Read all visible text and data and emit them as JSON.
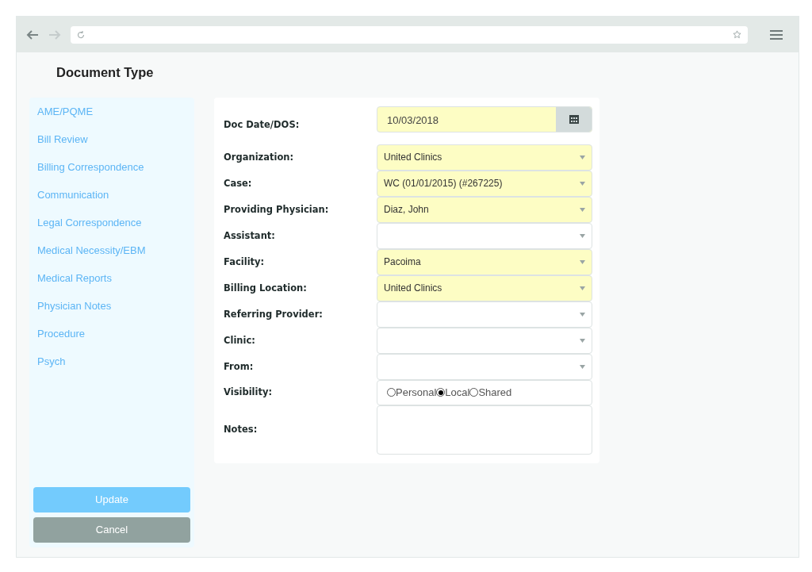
{
  "page_title": "Document Type",
  "sidebar": {
    "items": [
      {
        "label": "AME/PQME",
        "selected": false
      },
      {
        "label": "Bill Review",
        "selected": false
      },
      {
        "label": "Billing Correspondence",
        "selected": false
      },
      {
        "label": "Communication",
        "selected": false
      },
      {
        "label": "Legal Correspondence",
        "selected": false
      },
      {
        "label": "Medical Necessity/EBM",
        "selected": false
      },
      {
        "label": "Medical Reports",
        "selected": false
      },
      {
        "label": "Physician Notes",
        "selected": false
      },
      {
        "label": "Procedure",
        "selected": false
      },
      {
        "label": "Psych",
        "selected": false
      }
    ],
    "buttons": [
      {
        "label": "Update",
        "kind": "primary"
      },
      {
        "label": "Cancel",
        "kind": "secondary"
      }
    ]
  },
  "form": {
    "fields": [
      {
        "kind": "date",
        "label": "Doc Date/DOS:",
        "value": "10/03/2018",
        "highlighted": true
      },
      {
        "kind": "select",
        "label": "Organization:",
        "value": "United Clinics",
        "highlighted": true
      },
      {
        "kind": "select",
        "label": "Case:",
        "value": "WC (01/01/2015) (#267225)",
        "highlighted": true
      },
      {
        "kind": "select",
        "label": "Providing Physician:",
        "value": "Diaz, John",
        "highlighted": true
      },
      {
        "kind": "select",
        "label": "Assistant:",
        "highlighted": false
      },
      {
        "kind": "select",
        "label": "Facility:",
        "value": "Pacoima",
        "highlighted": true
      },
      {
        "kind": "select",
        "label": "Billing Location:",
        "value": "United Clinics",
        "highlighted": true
      },
      {
        "kind": "select",
        "label": "Referring Provider:",
        "highlighted": false
      },
      {
        "kind": "select",
        "label": "Clinic:",
        "highlighted": false
      },
      {
        "kind": "select",
        "label": "From:",
        "highlighted": false
      },
      {
        "kind": "radio",
        "label": "Visibility:",
        "options": [
          {
            "label": "Personal",
            "selected": false
          },
          {
            "label": "Local",
            "selected": true
          },
          {
            "label": "Shared",
            "selected": false
          }
        ]
      },
      {
        "kind": "textarea",
        "label": "Notes:"
      }
    ]
  }
}
